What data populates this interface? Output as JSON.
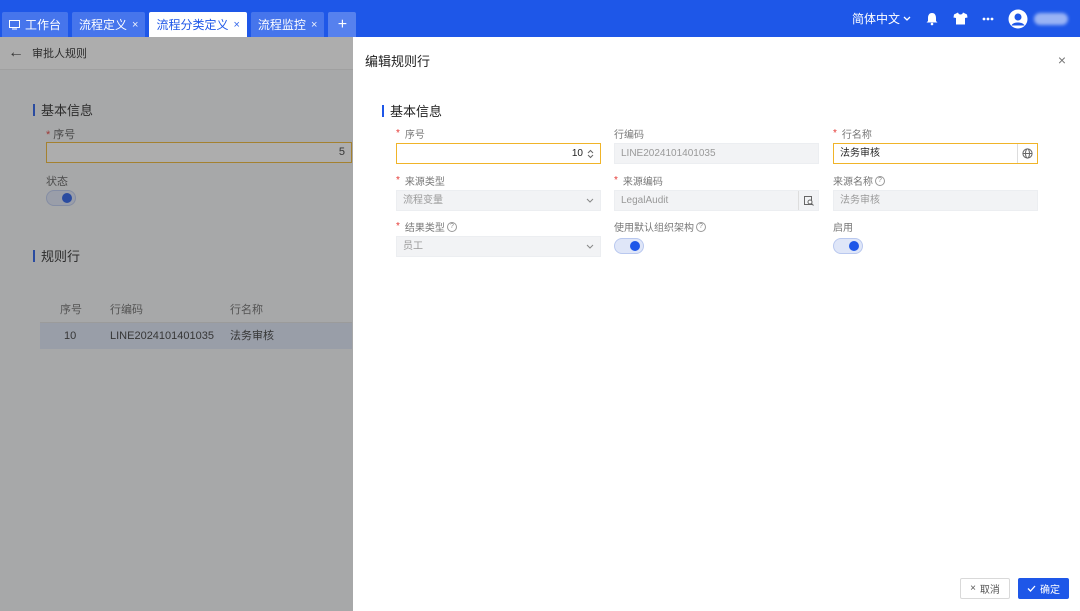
{
  "tabs": [
    {
      "label": "工作台",
      "icon": "monitor-icon",
      "closable": false,
      "active": false
    },
    {
      "label": "流程定义",
      "closable": true,
      "active": false
    },
    {
      "label": "流程分类定义",
      "closable": true,
      "active": true
    },
    {
      "label": "流程监控",
      "closable": true,
      "active": false
    }
  ],
  "tab_add_label": "+",
  "tab_close_glyph": "×",
  "topbar": {
    "language": "简体中文",
    "icons": [
      "bell-icon",
      "shirt-icon",
      "more-icon",
      "avatar"
    ]
  },
  "background_page": {
    "back_glyph": "←",
    "title": "审批人规则",
    "basic_section": "基本信息",
    "seq_label": "序号",
    "seq_value": "5",
    "status_label": "状态",
    "status_on": true,
    "rules_section": "规则行",
    "table": {
      "headers": [
        "序号",
        "行编码",
        "行名称"
      ],
      "rows": [
        [
          "10",
          "LINE2024101401035",
          "法务审核"
        ]
      ]
    }
  },
  "drawer": {
    "title": "编辑规则行",
    "close_glyph": "×",
    "section_title": "基本信息",
    "fields": {
      "seq": {
        "label": "序号",
        "value": "10",
        "required": true
      },
      "line_code": {
        "label": "行编码",
        "value": "LINE2024101401035"
      },
      "line_name": {
        "label": "行名称",
        "value": "法务审核",
        "required": true
      },
      "source_type": {
        "label": "来源类型",
        "value": "流程变量",
        "required": true
      },
      "source_code": {
        "label": "来源编码",
        "value": "LegalAudit",
        "required": true
      },
      "source_name": {
        "label": "来源名称",
        "value": "法务审核"
      },
      "result_type": {
        "label": "结果类型",
        "value": "员工",
        "required": true
      },
      "use_default_org": {
        "label": "使用默认组织架构",
        "on": true
      },
      "enabled": {
        "label": "启用",
        "on": true
      }
    },
    "cancel_label": "取消",
    "ok_label": "确定"
  },
  "colors": {
    "primary": "#1e57e8",
    "required": "#e53935",
    "focus_border": "#f0b429"
  }
}
